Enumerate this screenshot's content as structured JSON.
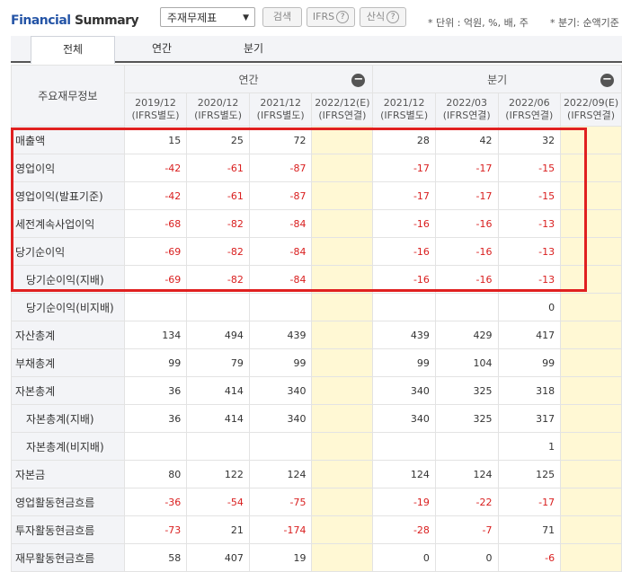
{
  "header": {
    "title_prefix": "Financial",
    "title_suffix": "Summary",
    "select_value": "주재무제표",
    "search_label": "검색",
    "ifrs_label": "IFRS",
    "formula_label": "산식",
    "unit_note": "* 단위 : 억원, %, 배, 주",
    "period_note": "* 분기: 순액기준"
  },
  "tabs": [
    "전체",
    "연간",
    "분기"
  ],
  "table": {
    "corner_label": "주요재무정보",
    "annual_label": "연간",
    "quarter_label": "분기",
    "columns": [
      {
        "period": "2019/12",
        "basis": "(IFRS별도)"
      },
      {
        "period": "2020/12",
        "basis": "(IFRS별도)"
      },
      {
        "period": "2021/12",
        "basis": "(IFRS별도)"
      },
      {
        "period": "2022/12(E)",
        "basis": "(IFRS연결)"
      },
      {
        "period": "2021/12",
        "basis": "(IFRS별도)"
      },
      {
        "period": "2022/03",
        "basis": "(IFRS연결)"
      },
      {
        "period": "2022/06",
        "basis": "(IFRS연결)"
      },
      {
        "period": "2022/09(E)",
        "basis": "(IFRS연결)"
      }
    ],
    "rows": [
      {
        "label": "매출액",
        "indent": false,
        "values": [
          "15",
          "25",
          "72",
          "",
          "28",
          "42",
          "32",
          ""
        ]
      },
      {
        "label": "영업이익",
        "indent": false,
        "values": [
          "-42",
          "-61",
          "-87",
          "",
          "-17",
          "-17",
          "-15",
          ""
        ]
      },
      {
        "label": "영업이익(발표기준)",
        "indent": false,
        "values": [
          "-42",
          "-61",
          "-87",
          "",
          "-17",
          "-17",
          "-15",
          ""
        ]
      },
      {
        "label": "세전계속사업이익",
        "indent": false,
        "values": [
          "-68",
          "-82",
          "-84",
          "",
          "-16",
          "-16",
          "-13",
          ""
        ]
      },
      {
        "label": "당기순이익",
        "indent": false,
        "values": [
          "-69",
          "-82",
          "-84",
          "",
          "-16",
          "-16",
          "-13",
          ""
        ]
      },
      {
        "label": "당기순이익(지배)",
        "indent": true,
        "values": [
          "-69",
          "-82",
          "-84",
          "",
          "-16",
          "-16",
          "-13",
          ""
        ]
      },
      {
        "label": "당기순이익(비지배)",
        "indent": true,
        "values": [
          "",
          "",
          "",
          "",
          "",
          "",
          "0",
          ""
        ]
      },
      {
        "label": "자산총계",
        "indent": false,
        "values": [
          "134",
          "494",
          "439",
          "",
          "439",
          "429",
          "417",
          ""
        ]
      },
      {
        "label": "부채총계",
        "indent": false,
        "values": [
          "99",
          "79",
          "99",
          "",
          "99",
          "104",
          "99",
          ""
        ]
      },
      {
        "label": "자본총계",
        "indent": false,
        "values": [
          "36",
          "414",
          "340",
          "",
          "340",
          "325",
          "318",
          ""
        ]
      },
      {
        "label": "자본총계(지배)",
        "indent": true,
        "values": [
          "36",
          "414",
          "340",
          "",
          "340",
          "325",
          "317",
          ""
        ]
      },
      {
        "label": "자본총계(비지배)",
        "indent": true,
        "values": [
          "",
          "",
          "",
          "",
          "",
          "",
          "1",
          ""
        ]
      },
      {
        "label": "자본금",
        "indent": false,
        "values": [
          "80",
          "122",
          "124",
          "",
          "124",
          "124",
          "125",
          ""
        ]
      },
      {
        "label": "영업활동현금흐름",
        "indent": false,
        "values": [
          "-36",
          "-54",
          "-75",
          "",
          "-19",
          "-22",
          "-17",
          ""
        ]
      },
      {
        "label": "투자활동현금흐름",
        "indent": false,
        "values": [
          "-73",
          "21",
          "-174",
          "",
          "-28",
          "-7",
          "71",
          ""
        ]
      },
      {
        "label": "재무활동현금흐름",
        "indent": false,
        "values": [
          "58",
          "407",
          "19",
          "",
          "0",
          "0",
          "-6",
          ""
        ]
      }
    ]
  },
  "colors": {
    "accent": "#2454a6",
    "negative": "#d91e1e",
    "estimate_bg": "#fff8d4",
    "highlight": "#e02020"
  }
}
